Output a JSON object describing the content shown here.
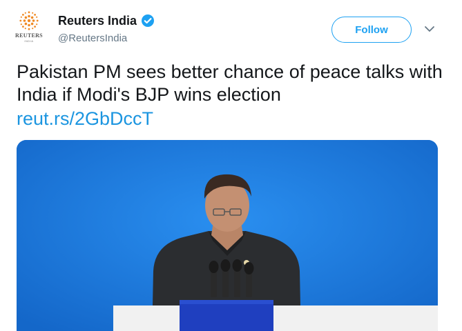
{
  "account": {
    "display_name": "Reuters India",
    "handle": "@ReutersIndia",
    "verified": true,
    "logo_text": "REUTERS",
    "logo_subtext": "INDIA"
  },
  "actions": {
    "follow_label": "Follow",
    "menu_icon": "chevron-down-icon"
  },
  "tweet": {
    "text": "Pakistan PM sees better chance of peace talks with India if Modi's BJP wins election",
    "link": "reut.rs/2GbDccT"
  },
  "colors": {
    "brand_blue": "#1da1f2",
    "link_blue": "#1b95e0",
    "text": "#14171a",
    "secondary_text": "#657786",
    "backdrop_blue": "#1a7ee0",
    "logo_orange": "#f08a24"
  }
}
